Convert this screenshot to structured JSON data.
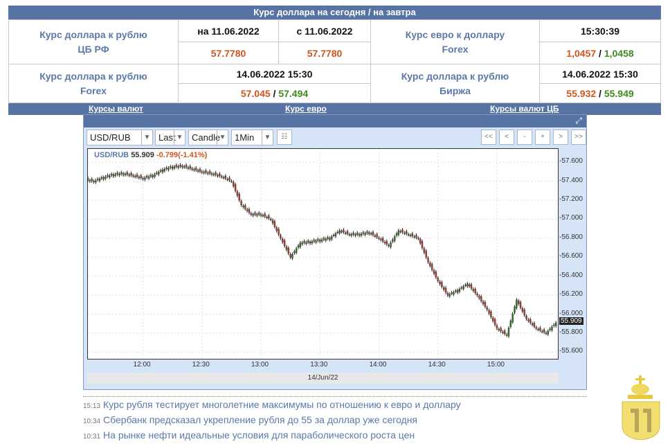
{
  "header": {
    "title": "Курс доллара на сегодня / на завтра"
  },
  "rates": {
    "cb": {
      "label1": "Курс доллара к рублю",
      "label2": "ЦБ РФ",
      "date1": "на 11.06.2022",
      "date2": "с 11.06.2022",
      "val1": "57.7780",
      "val2": "57.7780"
    },
    "eurusd": {
      "label1": "Курс евро к доллару",
      "label2": "Forex",
      "time": "15:30:39",
      "bid": "1,0457",
      "ask": "1,0458"
    },
    "forex": {
      "label1": "Курс доллара к рублю",
      "label2": "Forex",
      "time": "14.06.2022 15:30",
      "bid": "57.045",
      "ask": "57.494"
    },
    "exchange": {
      "label1": "Курс доллара к рублю",
      "label2": "Биржа",
      "time": "14.06.2022 15:30",
      "bid": "55.932",
      "ask": "55.949"
    },
    "sep": " / "
  },
  "nav": {
    "links": [
      "Курсы валют",
      "Курс евро",
      "Курсы валют ЦБ"
    ]
  },
  "toolbar": {
    "symbol": "USD/RUB",
    "price_type": "Last",
    "chart_type": "Candle",
    "interval": "1Min",
    "nav_buttons": [
      "<<",
      "<",
      "-",
      "+",
      ">",
      ">>"
    ]
  },
  "chart_data": {
    "type": "candlestick",
    "symbol": "USD/RUB",
    "last": "55.909",
    "change": "-0.799(-1.41%)",
    "x_ticks": [
      "12:00",
      "12:30",
      "13:00",
      "13:30",
      "14:00",
      "14:30",
      "15:00"
    ],
    "date_label": "14/Jun/22",
    "y_ticks": [
      "57.600",
      "57.400",
      "57.200",
      "57.000",
      "56.800",
      "56.600",
      "56.400",
      "56.200",
      "56.000",
      "55.800",
      "55.600"
    ],
    "ylim": [
      55.53,
      57.74
    ],
    "xlim": [
      "11:32",
      "15:31"
    ],
    "last_marker": "55.909",
    "grid": true,
    "times": [
      "11:35",
      "11:40",
      "11:45",
      "11:50",
      "11:55",
      "12:00",
      "12:05",
      "12:10",
      "12:15",
      "12:20",
      "12:25",
      "12:30",
      "12:35",
      "12:40",
      "12:45",
      "12:50",
      "12:55",
      "13:00",
      "13:05",
      "13:10",
      "13:15",
      "13:20",
      "13:25",
      "13:30",
      "13:35",
      "13:40",
      "13:45",
      "13:50",
      "13:55",
      "14:00",
      "14:05",
      "14:10",
      "14:15",
      "14:20",
      "14:25",
      "14:30",
      "14:35",
      "14:40",
      "14:45",
      "14:50",
      "14:55",
      "15:00",
      "15:05",
      "15:10",
      "15:15",
      "15:20",
      "15:25",
      "15:30"
    ],
    "close": [
      57.4,
      57.44,
      57.47,
      57.48,
      57.46,
      57.43,
      57.46,
      57.52,
      57.55,
      57.56,
      57.53,
      57.5,
      57.48,
      57.45,
      57.4,
      57.15,
      57.05,
      57.05,
      57.0,
      56.8,
      56.6,
      56.75,
      56.76,
      56.78,
      56.8,
      56.88,
      56.84,
      56.84,
      56.86,
      56.8,
      56.72,
      56.88,
      56.84,
      56.8,
      56.55,
      56.35,
      56.2,
      56.25,
      56.32,
      56.2,
      56.05,
      55.85,
      55.78,
      56.15,
      55.95,
      55.85,
      55.8,
      55.909
    ],
    "colors": {
      "up": "#2e7d1e",
      "down": "#c0392b"
    }
  },
  "news": [
    {
      "time": "15:13",
      "text": "Курс рубля тестирует многолетние максимумы по отношению к евро и доллару"
    },
    {
      "time": "10:34",
      "text": "Сбербанк предсказал укрепление рубля до 55 за доллар уже сегодня"
    },
    {
      "time": "10:31",
      "text": "На рынке нефти идеальные условия для параболического роста цен"
    }
  ]
}
